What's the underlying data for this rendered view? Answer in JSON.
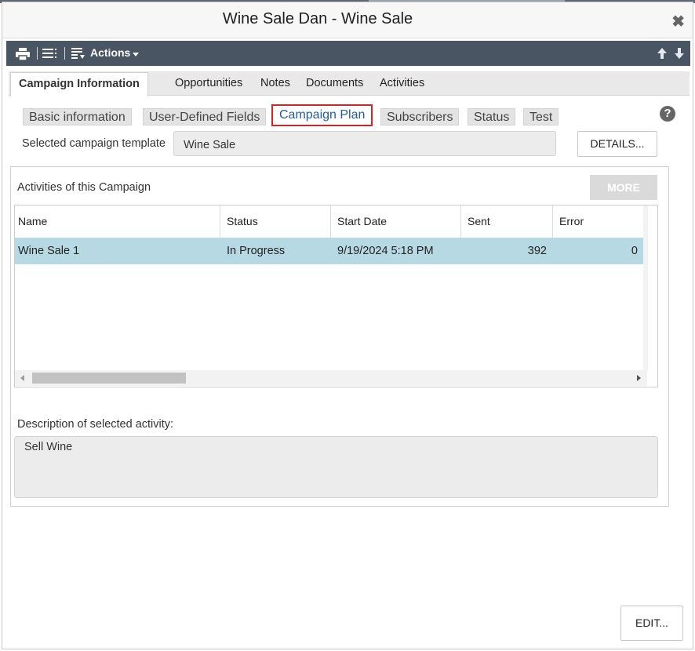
{
  "window": {
    "title": "Wine Sale Dan - Wine Sale",
    "close_glyph": "✖"
  },
  "toolbar": {
    "icons": [
      "print-icon",
      "list-icon",
      "actions-list-icon",
      "arrow-up-icon",
      "arrow-down-icon"
    ],
    "actions_label": "Actions"
  },
  "tabs": [
    {
      "label": "Campaign Information",
      "active": true
    },
    {
      "label": "Opportunities"
    },
    {
      "label": "Notes"
    },
    {
      "label": "Documents"
    },
    {
      "label": "Activities"
    }
  ],
  "subtabs": [
    {
      "label": "Basic information"
    },
    {
      "label": "User-Defined Fields"
    },
    {
      "label": "Campaign Plan",
      "selected": true
    },
    {
      "label": "Subscribers"
    },
    {
      "label": "Status"
    },
    {
      "label": "Test"
    }
  ],
  "help_glyph": "?",
  "template": {
    "label": "Selected campaign template",
    "value": "Wine Sale",
    "details_button": "DETAILS..."
  },
  "activities": {
    "label": "Activities of this Campaign",
    "more_button": "MORE",
    "columns": [
      "Name",
      "Status",
      "Start Date",
      "Sent",
      "Error"
    ],
    "rows": [
      {
        "name": "Wine Sale 1",
        "status": "In Progress",
        "start_date": "9/19/2024 5:18 PM",
        "sent": "392",
        "error": "0"
      }
    ]
  },
  "description": {
    "label": "Description of selected activity:",
    "value": "Sell Wine"
  },
  "edit_button": "EDIT...",
  "colors": {
    "toolbar": "#4a5563",
    "selected_row": "#b7d9e3",
    "selected_subtab_border": "#d22424",
    "selected_subtab_text": "#1f5f97"
  }
}
